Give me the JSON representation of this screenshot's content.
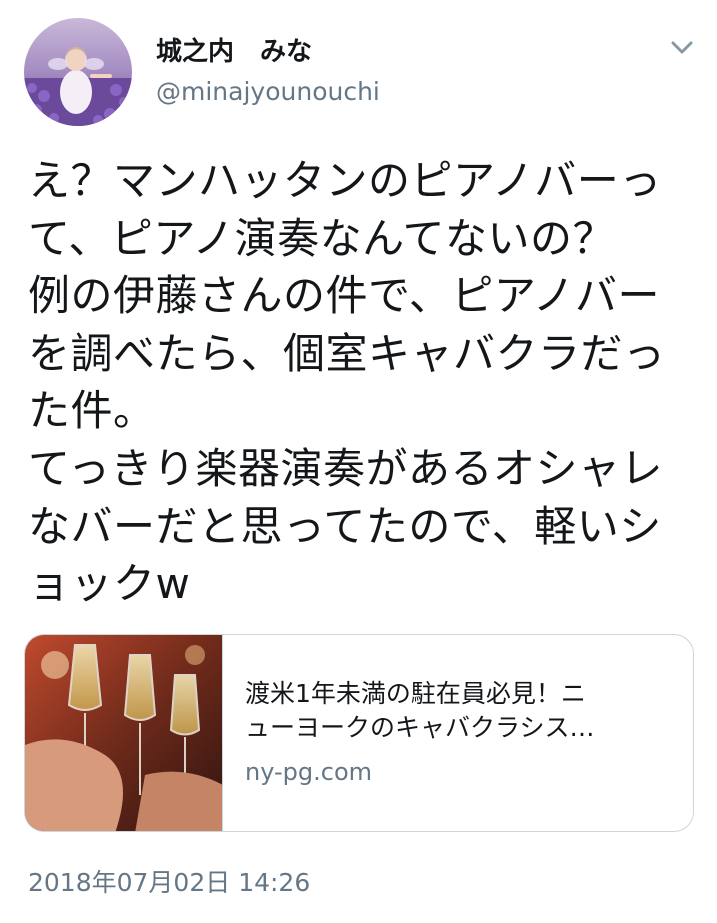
{
  "user": {
    "display_name": "城之内　みな",
    "handle": "@minajyounouchi"
  },
  "tweet": {
    "text": "え？マンハッタンのピアノバーって、ピアノ演奏なんてないの？\n例の伊藤さんの件で、ピアノバーを調べたら、個室キャバクラだった件。\nてっきり楽器演奏があるオシャレなバーだと思ってたので、軽いショックw",
    "timestamp": "2018年07月02日 14:26"
  },
  "card": {
    "title_line1": "渡米1年未満の駐在員必見！ニ",
    "title_line2": "ューヨークのキャバクラシス…",
    "domain": "ny-pg.com"
  },
  "icons": {
    "menu": "chevron-down-icon",
    "avatar": "avatar-image"
  },
  "colors": {
    "text_primary": "#14171a",
    "text_secondary": "#657786",
    "border": "#ccd6dd"
  }
}
